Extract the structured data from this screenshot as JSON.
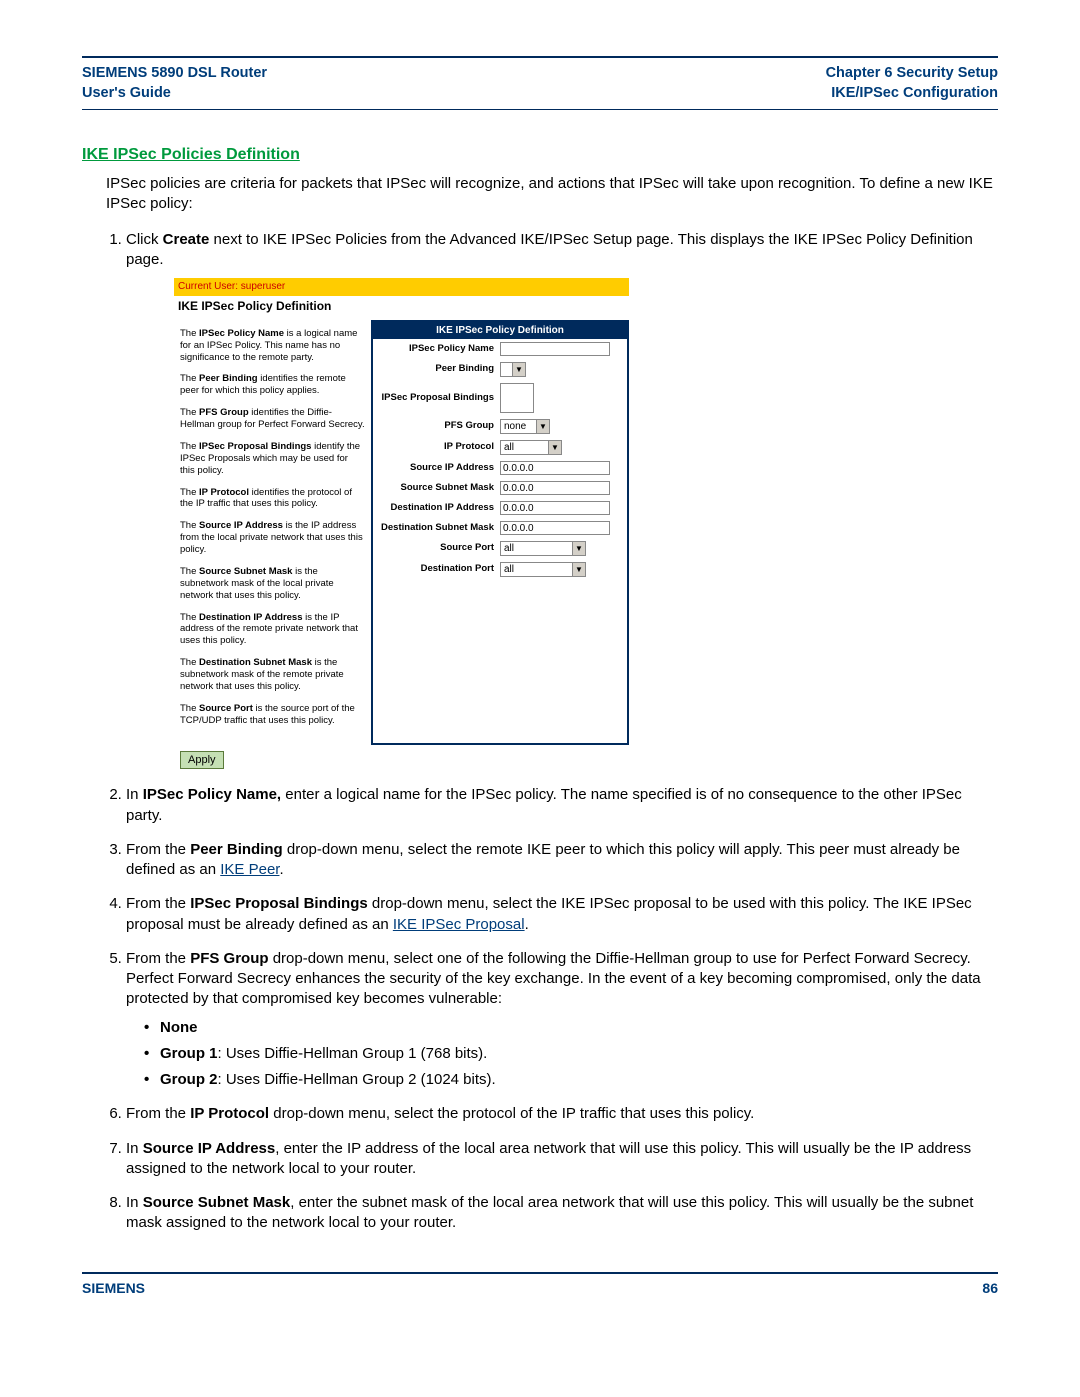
{
  "header": {
    "left_line1": "SIEMENS 5890 DSL Router",
    "left_line2": "User's Guide",
    "right_line1": "Chapter 6  Security Setup",
    "right_line2": "IKE/IPSec Configuration"
  },
  "section_title": "IKE IPSec Policies Definition",
  "intro": "IPSec policies are criteria for packets that IPSec will recognize, and actions that IPSec will take upon recognition. To define a new IKE IPSec policy:",
  "step1_pre": "Click ",
  "step1_b": "Create",
  "step1_post": " next to IKE IPSec Policies from the Advanced IKE/IPSec Setup page. This displays the IKE IPSec Policy Definition page.",
  "shot": {
    "userbar": "Current User: superuser",
    "title": "IKE IPSec Policy Definition",
    "right_header": "IKE IPSec Policy Definition",
    "left_paras": {
      "p1a": "The ",
      "p1b": "IPSec Policy Name",
      "p1c": " is a logical name for an IPSec Policy. This name has no significance to the remote party.",
      "p2a": "The ",
      "p2b": "Peer Binding",
      "p2c": " identifies the remote peer for which this policy applies.",
      "p3a": "The ",
      "p3b": "PFS Group",
      "p3c": " identifies the Diffie-Hellman group for Perfect Forward Secrecy.",
      "p4a": "The ",
      "p4b": "IPSec Proposal Bindings",
      "p4c": " identify the IPSec Proposals which may be used for this policy.",
      "p5a": "The ",
      "p5b": "IP Protocol",
      "p5c": " identifies the protocol of the IP traffic that uses this policy.",
      "p6a": "The ",
      "p6b": "Source IP Address",
      "p6c": " is the IP address from the local private network that uses this policy.",
      "p7a": "The ",
      "p7b": "Source Subnet Mask",
      "p7c": " is the subnetwork mask of the local private network that uses this policy.",
      "p8a": "The ",
      "p8b": "Destination IP Address",
      "p8c": " is the IP address of the remote private network that uses this policy.",
      "p9a": "The ",
      "p9b": "Destination Subnet Mask",
      "p9c": " is the subnetwork mask of the remote private network that uses this policy.",
      "p10a": "The ",
      "p10b": "Source Port",
      "p10c": " is the source port of the TCP/UDP traffic that uses this policy."
    },
    "labels": {
      "policy_name": "IPSec Policy Name",
      "peer_binding": "Peer Binding",
      "proposal_bindings": "IPSec Proposal Bindings",
      "pfs_group": "PFS Group",
      "ip_protocol": "IP Protocol",
      "src_ip": "Source IP Address",
      "src_mask": "Source Subnet Mask",
      "dst_ip": "Destination IP Address",
      "dst_mask": "Destination Subnet Mask",
      "src_port": "Source Port",
      "dst_port": "Destination Port"
    },
    "values": {
      "pfs_group": "none",
      "ip_protocol": "all",
      "src_ip": "0.0.0.0",
      "src_mask": "0.0.0.0",
      "dst_ip": "0.0.0.0",
      "dst_mask": "0.0.0.0",
      "src_port": "all",
      "dst_port": "all"
    },
    "apply": "Apply"
  },
  "step2_pre": "In ",
  "step2_b": "IPSec Policy Name,",
  "step2_post": " enter a logical name for the IPSec policy. The name specified is of no consequence to the other IPSec party.",
  "step3_pre": "From the ",
  "step3_b": "Peer Binding",
  "step3_mid": " drop-down menu, select the remote IKE peer to which this policy will apply. This peer must already be defined as an ",
  "step3_link": "IKE Peer",
  "step3_end": ".",
  "step4_pre": "From the ",
  "step4_b": "IPSec Proposal Bindings",
  "step4_mid": " drop-down menu, select the IKE IPSec proposal to be used with this policy. The IKE IPSec proposal must be already defined as an ",
  "step4_link": "IKE IPSec Proposal",
  "step4_end": ".",
  "step5_pre": "From the ",
  "step5_b": "PFS Group",
  "step5_post": " drop-down menu, select one of the following the Diffie-Hellman group to use for Perfect Forward Secrecy. Perfect Forward Secrecy enhances the security of the key exchange. In the event of a key becoming compromised, only the data protected by that compromised key becomes vulnerable:",
  "bullet_none": "None",
  "bullet_g1_b": "Group 1",
  "bullet_g1_t": ": Uses Diffie-Hellman Group 1 (768 bits).",
  "bullet_g2_b": "Group 2",
  "bullet_g2_t": ": Uses Diffie-Hellman Group 2 (1024 bits).",
  "step6_pre": "From the ",
  "step6_b": "IP Protocol",
  "step6_post": " drop-down menu, select the protocol of the IP traffic that uses this policy.",
  "step7_pre": "In ",
  "step7_b": "Source IP Address",
  "step7_post": ", enter the IP address of the local area network that will use this policy. This will usually be the IP address assigned to the network local to your router.",
  "step8_pre": "In ",
  "step8_b": "Source Subnet Mask",
  "step8_post": ", enter the subnet mask of the local area network that will use this policy. This will usually be the subnet mask assigned to the network local to your router.",
  "footer": {
    "brand": "SIEMENS",
    "page": "86"
  }
}
